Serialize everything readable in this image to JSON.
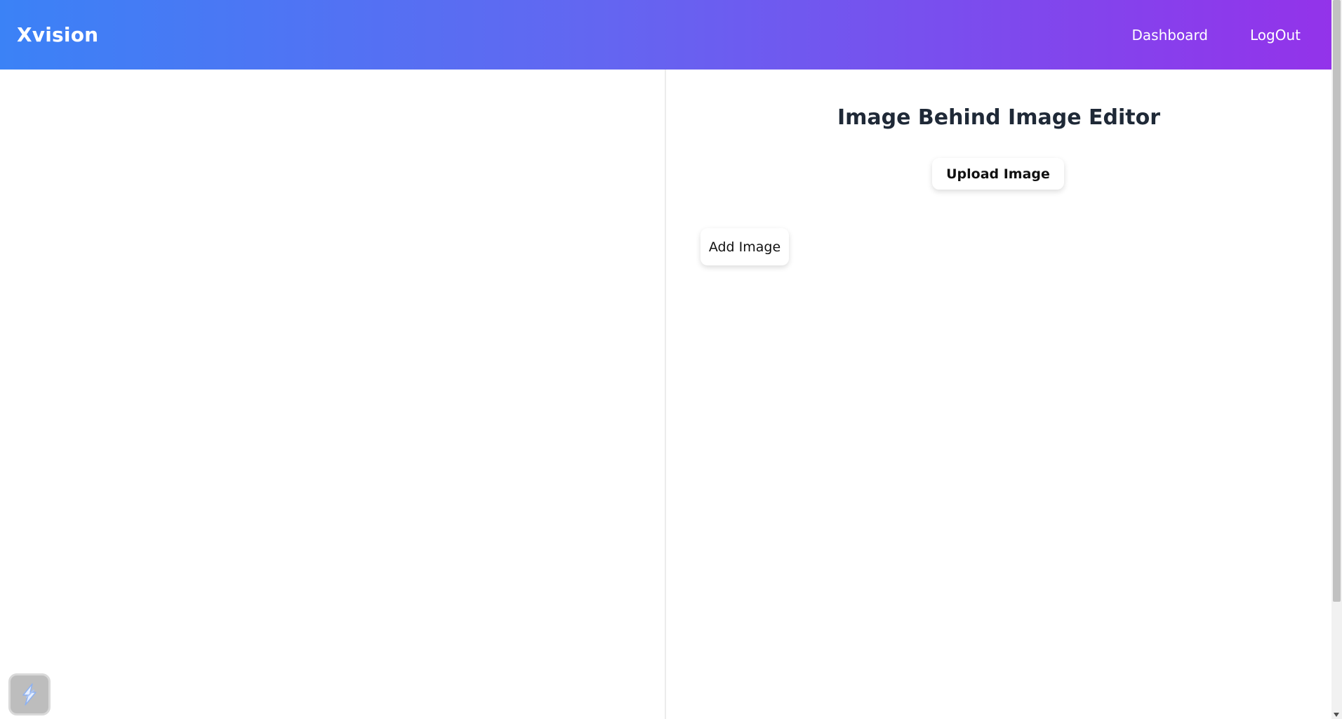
{
  "header": {
    "brand": "Xvision",
    "nav": [
      {
        "label": "Dashboard"
      },
      {
        "label": "LogOut"
      }
    ],
    "gradient_start": "#3b82f6",
    "gradient_end": "#9333ea"
  },
  "editor": {
    "title": "Image Behind Image Editor",
    "upload_label": "Upload Image",
    "add_label": "Add Image"
  },
  "widget": {
    "icon": "lightning-bolt-icon"
  }
}
